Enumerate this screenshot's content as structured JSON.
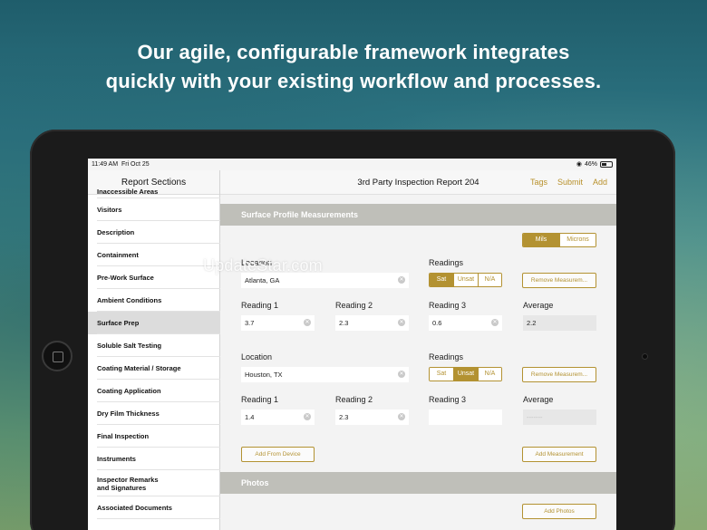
{
  "headline": {
    "line1": "Our agile, configurable framework integrates",
    "line2": "quickly with your existing workflow and processes."
  },
  "status": {
    "time": "11:49 AM",
    "date": "Fri Oct 25",
    "battery": "46%"
  },
  "sidebar": {
    "title": "Report Sections",
    "items": [
      {
        "label": "Inaccessible Areas"
      },
      {
        "label": "Visitors"
      },
      {
        "label": "Description"
      },
      {
        "label": "Containment"
      },
      {
        "label": "Pre-Work Surface"
      },
      {
        "label": "Ambient Conditions"
      },
      {
        "label": "Surface Prep",
        "active": true
      },
      {
        "label": "Soluble Salt Testing"
      },
      {
        "label": "Coating Material / Storage"
      },
      {
        "label": "Coating Application"
      },
      {
        "label": "Dry Film Thickness"
      },
      {
        "label": "Final Inspection"
      },
      {
        "label": "Instruments"
      },
      {
        "label": "Inspector Remarks and Signatures",
        "line1": "Inspector Remarks",
        "line2": "and Signatures"
      },
      {
        "label": "Associated Documents"
      }
    ]
  },
  "navbar": {
    "title": "3rd Party Inspection Report 204",
    "actions": [
      "Tags",
      "Submit",
      "Add"
    ]
  },
  "surface": {
    "section_title": "Surface Profile Measurements",
    "units": {
      "options": [
        "Mils",
        "Microns"
      ],
      "selected": "Mils"
    },
    "labels": {
      "location": "Location",
      "readings": "Readings",
      "reading1": "Reading 1",
      "reading2": "Reading 2",
      "reading3": "Reading 3",
      "average": "Average"
    },
    "readings_options": [
      "Sat",
      "Unsat",
      "N/A"
    ],
    "remove_label": "Remove Measurem...",
    "measurements": [
      {
        "location": "Atlanta, GA",
        "selected": "Sat",
        "r1": "3.7",
        "r2": "2.3",
        "r3": "0.6",
        "avg": "2.2"
      },
      {
        "location": "Houston, TX",
        "selected": "Unsat",
        "r1": "1.4",
        "r2": "2.3",
        "r3": "",
        "avg": "-------"
      }
    ],
    "add_from_device": "Add From Device",
    "add_measurement": "Add Measurement"
  },
  "photos": {
    "section_title": "Photos",
    "add_label": "Add Photos"
  },
  "watermark": "UpdateStar.com",
  "colors": {
    "accent": "#b39232",
    "section_bar": "#bfbfb9"
  }
}
